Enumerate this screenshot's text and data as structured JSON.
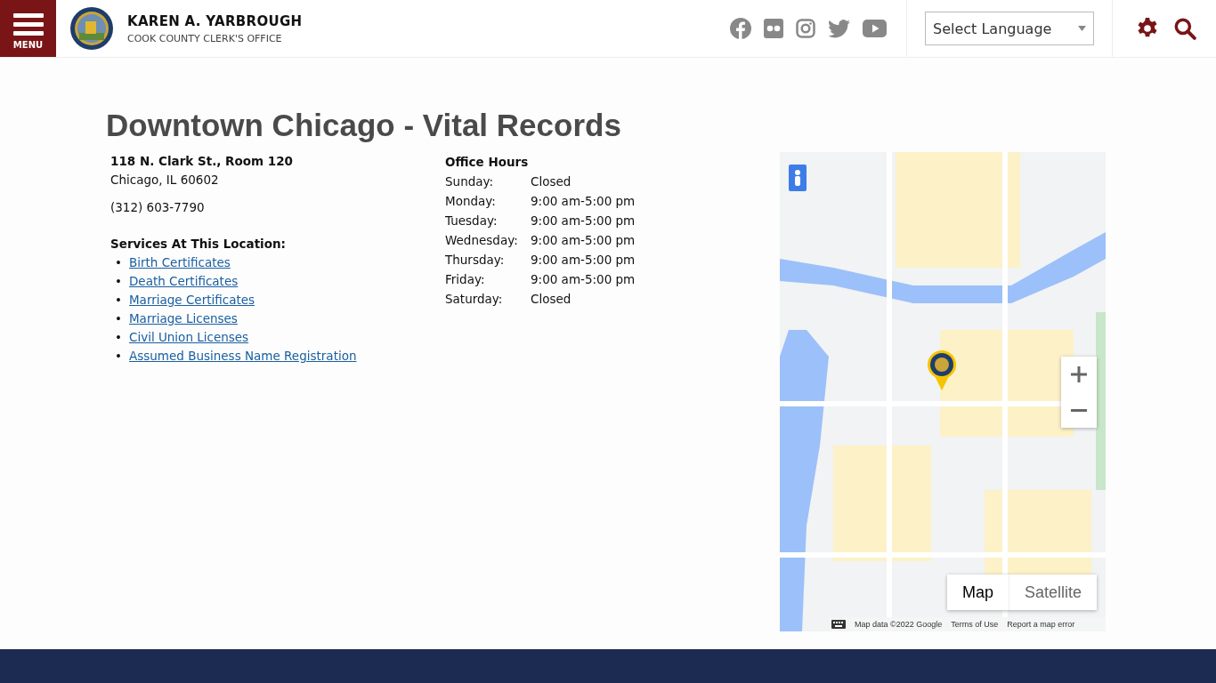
{
  "header": {
    "menu_label": "MENU",
    "name": "KAREN A. YARBROUGH",
    "subtitle": "COOK COUNTY CLERK'S OFFICE",
    "language_select": "Select Language"
  },
  "title": "Downtown Chicago - Vital Records",
  "address": {
    "line1": "118 N. Clark St., Room 120",
    "line2": "Chicago, IL 60602",
    "phone": "(312) 603-7790"
  },
  "services": {
    "heading": "Services At This Location:",
    "links": [
      {
        "marker": "•",
        "label": "Birth Certificates"
      },
      {
        "marker": "•",
        "label": "Death Certificates"
      },
      {
        "marker": "•",
        "label": "Marriage Certificates"
      },
      {
        "marker": "•",
        "label": "Marriage Licenses"
      },
      {
        "marker": "•",
        "label": "Civil Union Licenses"
      },
      {
        "marker": "•",
        "label": "Assumed Business Name Registration"
      }
    ]
  },
  "hours": {
    "heading": "Office Hours",
    "rows": [
      {
        "day": "Sunday:",
        "time": "Closed"
      },
      {
        "day": "Monday:",
        "time": "9:00 am-5:00 pm"
      },
      {
        "day": "Tuesday:",
        "time": "9:00 am-5:00 pm"
      },
      {
        "day": "Wednesday:",
        "time": "9:00 am-5:00 pm"
      },
      {
        "day": "Thursday:",
        "time": "9:00 am-5:00 pm"
      },
      {
        "day": "Friday:",
        "time": "9:00 am-5:00 pm"
      },
      {
        "day": "Saturday:",
        "time": "Closed"
      }
    ]
  },
  "map": {
    "types": [
      {
        "label": "Map",
        "selected": true
      },
      {
        "label": "Satellite",
        "selected": false
      }
    ],
    "attribution": [
      "Map data ©2022 Google",
      "Terms of Use",
      "Report a map error"
    ]
  }
}
